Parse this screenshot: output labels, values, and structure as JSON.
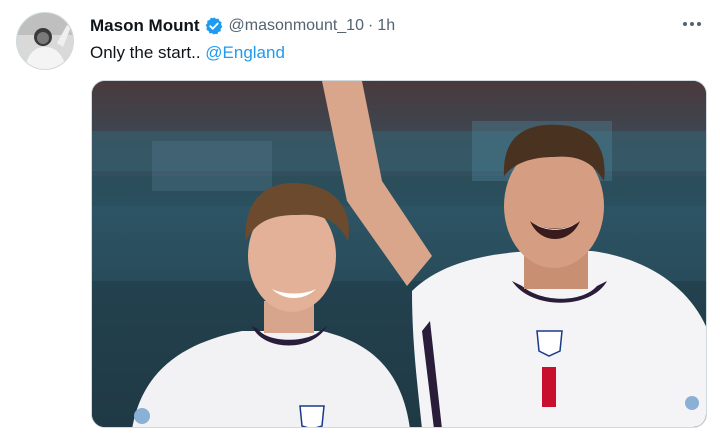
{
  "tweet": {
    "author": {
      "display_name": "Mason Mount",
      "verified": true,
      "handle": "@masonmount_10",
      "separator": "·",
      "time": "1h"
    },
    "text": {
      "body": "Only the start.. ",
      "mention": "@England"
    },
    "more_icon": "more-dots-icon",
    "media": {
      "type": "photo"
    }
  },
  "colors": {
    "link": "#1d9bf0",
    "verified": "#1d9bf0",
    "secondary_text": "#536471"
  }
}
